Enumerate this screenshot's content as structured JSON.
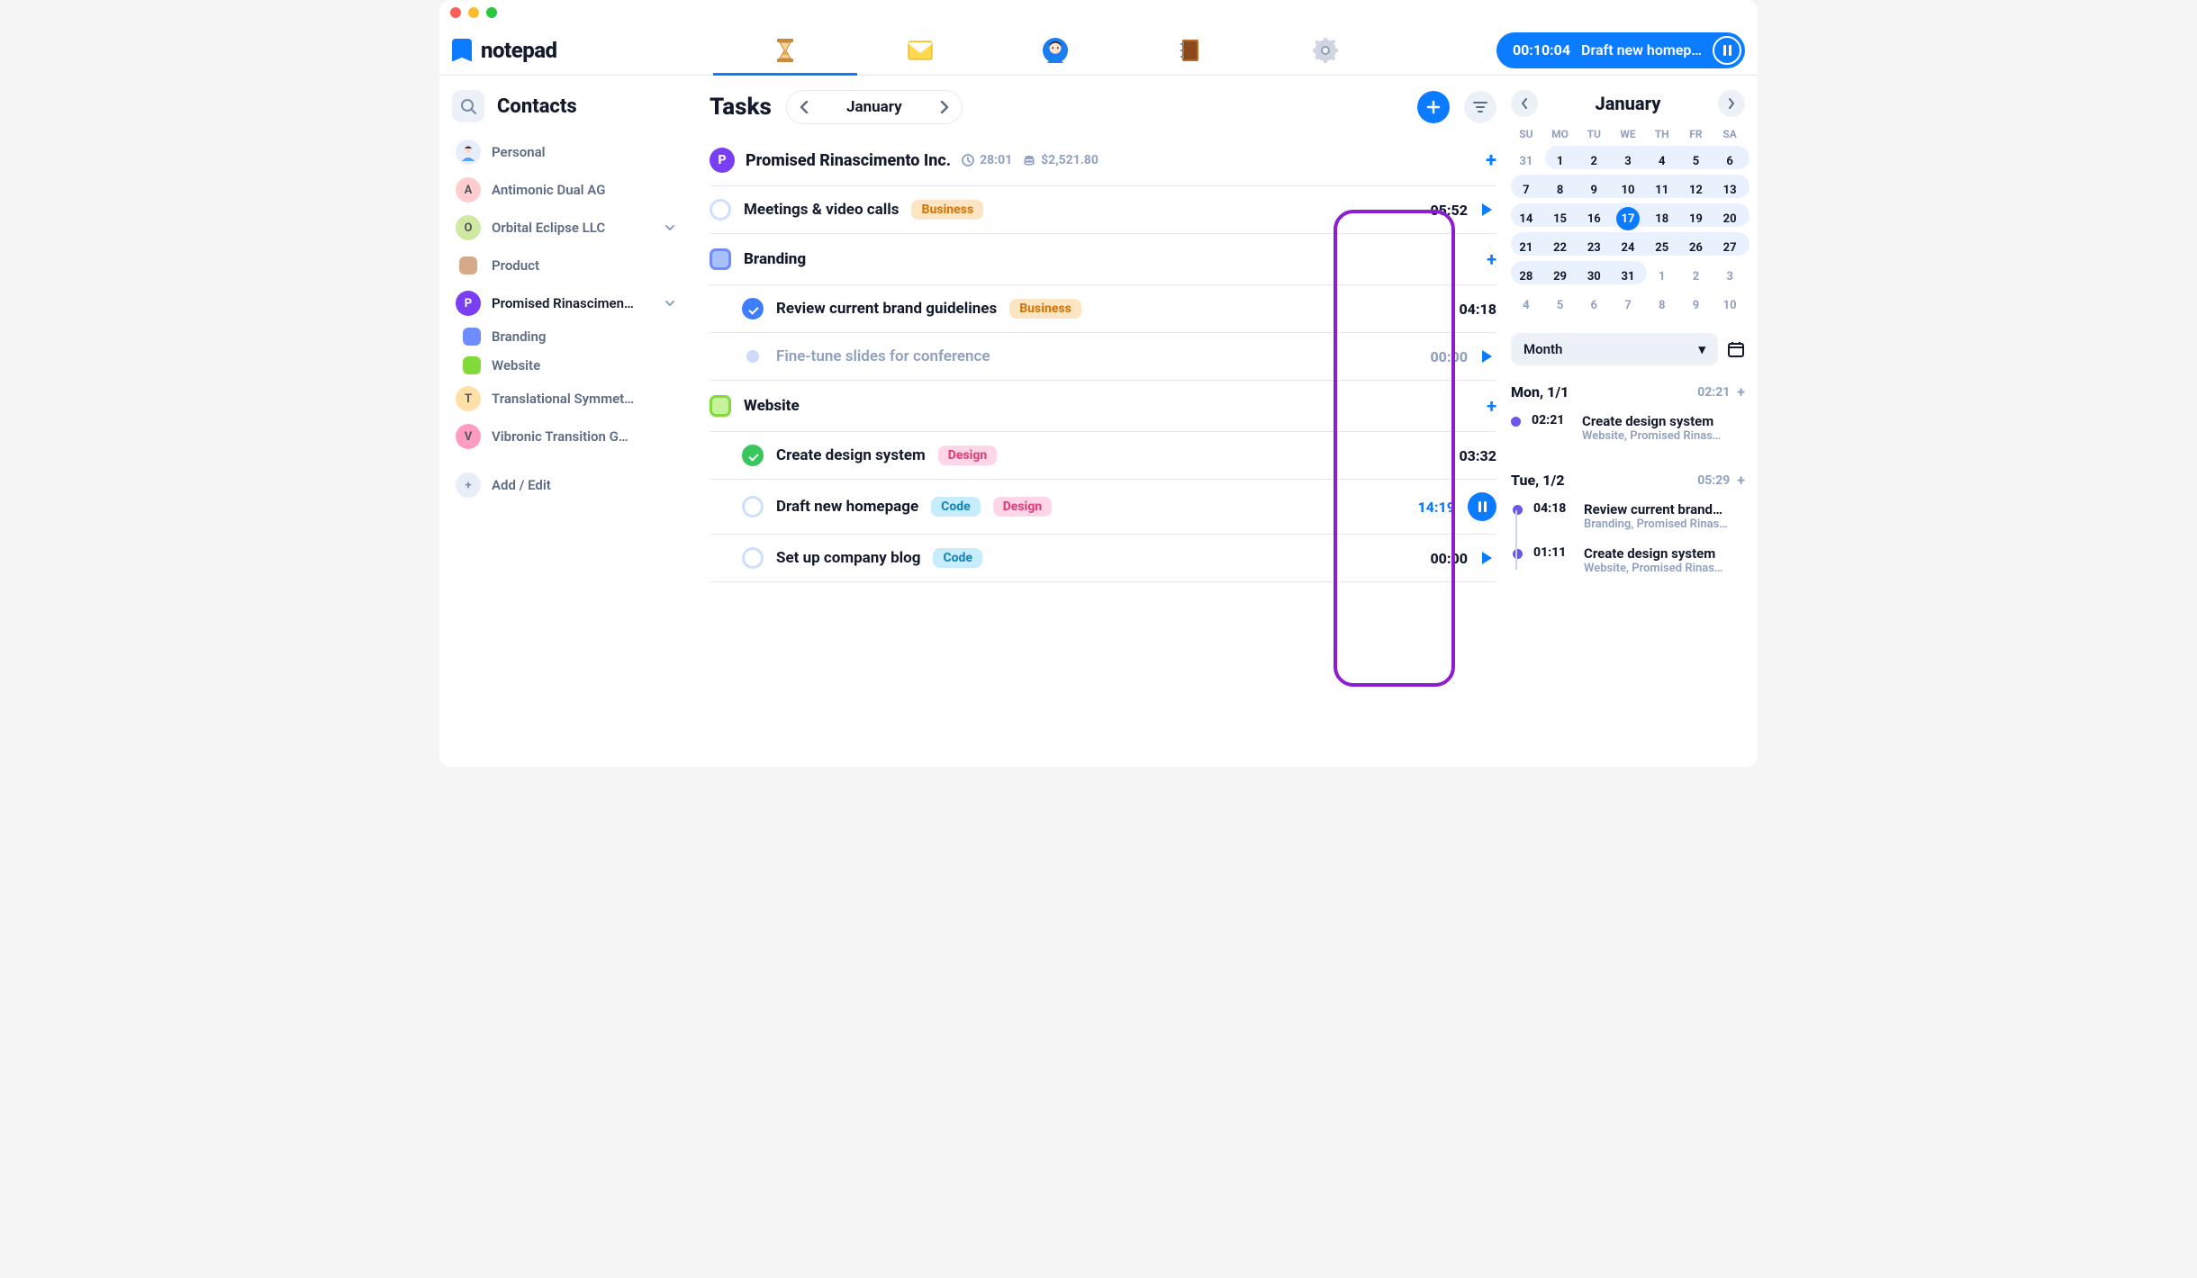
{
  "app": {
    "name": "notepad"
  },
  "timer": {
    "elapsed": "00:10:04",
    "task": "Draft new homep…"
  },
  "sidebar": {
    "title": "Contacts",
    "items": [
      {
        "label": "Personal",
        "kind": "avatar"
      },
      {
        "label": "Antimonic Dual AG",
        "initial": "A",
        "color": "#ffcdd0"
      },
      {
        "label": "Orbital Eclipse LLC",
        "initial": "O",
        "color": "#cfe9a3",
        "expandable": true
      },
      {
        "label": "Product",
        "kind": "square",
        "color": "#d6a989"
      },
      {
        "label": "Promised Rinascimen…",
        "initial": "P",
        "color": "#7a3ff2",
        "bold": true,
        "expandable": true,
        "children": [
          {
            "label": "Branding",
            "color": "#6f8cff"
          },
          {
            "label": "Website",
            "color": "#82d93a"
          }
        ]
      },
      {
        "label": "Translational Symmet…",
        "initial": "T",
        "color": "#ffe0a6"
      },
      {
        "label": "Vibronic Transition G…",
        "initial": "V",
        "color": "#ff9cc0"
      }
    ],
    "add": "Add / Edit"
  },
  "main": {
    "title": "Tasks",
    "month": "January",
    "group": {
      "initial": "P",
      "name": "Promised Rinascimento Inc.",
      "time": "28:01",
      "amount": "$2,521.80"
    },
    "rows": [
      {
        "type": "task",
        "name": "Meetings & video calls",
        "tags": [
          "Business"
        ],
        "dur": "05:52",
        "action": "play"
      },
      {
        "type": "section",
        "name": "Branding",
        "color": "#a8c0ff",
        "border": "#6f8cff"
      },
      {
        "type": "task",
        "sub": true,
        "name": "Review current brand guidelines",
        "tags": [
          "Business"
        ],
        "dur": "04:18",
        "check": "done-blue"
      },
      {
        "type": "task",
        "sub": true,
        "name": "Fine-tune slides for conference",
        "dur": "00:00",
        "dim": true,
        "action": "play",
        "check": "dot-dim"
      },
      {
        "type": "section",
        "name": "Website",
        "color": "#c5f29b",
        "border": "#82d93a"
      },
      {
        "type": "task",
        "sub": true,
        "name": "Create design system",
        "tags": [
          "Design"
        ],
        "dur": "03:32",
        "check": "done-green"
      },
      {
        "type": "task",
        "sub": true,
        "name": "Draft new homepage",
        "tags": [
          "Code",
          "Design"
        ],
        "dur": "14:19",
        "action": "pause",
        "active": true
      },
      {
        "type": "task",
        "sub": true,
        "name": "Set up company blog",
        "tags": [
          "Code"
        ],
        "dur": "00:00",
        "action": "play"
      }
    ]
  },
  "calendar": {
    "month": "January",
    "dow": [
      "SU",
      "MO",
      "TU",
      "WE",
      "TH",
      "FR",
      "SA"
    ],
    "weeks": [
      [
        {
          "d": 31,
          "out": true
        },
        {
          "d": 1
        },
        {
          "d": 2
        },
        {
          "d": 3
        },
        {
          "d": 4
        },
        {
          "d": 5
        },
        {
          "d": 6
        }
      ],
      [
        {
          "d": 7
        },
        {
          "d": 8
        },
        {
          "d": 9
        },
        {
          "d": 10
        },
        {
          "d": 11
        },
        {
          "d": 12
        },
        {
          "d": 13
        }
      ],
      [
        {
          "d": 14
        },
        {
          "d": 15
        },
        {
          "d": 16
        },
        {
          "d": 17,
          "today": true
        },
        {
          "d": 18
        },
        {
          "d": 19
        },
        {
          "d": 20
        }
      ],
      [
        {
          "d": 21
        },
        {
          "d": 22
        },
        {
          "d": 23
        },
        {
          "d": 24
        },
        {
          "d": 25
        },
        {
          "d": 26
        },
        {
          "d": 27
        }
      ],
      [
        {
          "d": 28
        },
        {
          "d": 29
        },
        {
          "d": 30
        },
        {
          "d": 31
        },
        {
          "d": 1,
          "out": true
        },
        {
          "d": 2,
          "out": true
        },
        {
          "d": 3,
          "out": true
        }
      ],
      [
        {
          "d": 4,
          "out": true
        },
        {
          "d": 5,
          "out": true
        },
        {
          "d": 6,
          "out": true
        },
        {
          "d": 7,
          "out": true
        },
        {
          "d": 8,
          "out": true
        },
        {
          "d": 9,
          "out": true
        },
        {
          "d": 10,
          "out": true
        }
      ]
    ],
    "range": "Month",
    "days": [
      {
        "label": "Mon, 1/1",
        "total": "02:21",
        "entries": [
          {
            "time": "02:21",
            "title": "Create design system",
            "sub": "Website, Promised Rinas…"
          }
        ]
      },
      {
        "label": "Tue, 1/2",
        "total": "05:29",
        "entries": [
          {
            "time": "04:18",
            "title": "Review current brand…",
            "sub": "Branding, Promised Rinas…"
          },
          {
            "time": "01:11",
            "title": "Create design system",
            "sub": "Website, Promised Rinas…"
          }
        ]
      }
    ]
  }
}
